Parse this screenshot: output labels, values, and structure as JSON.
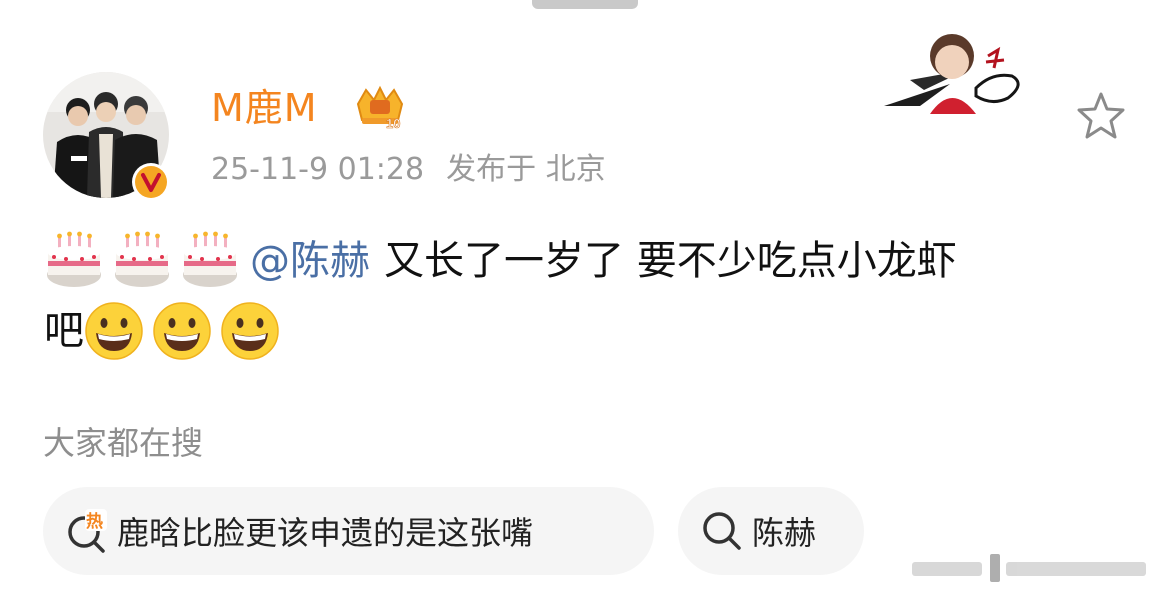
{
  "post": {
    "author": {
      "name": "M鹿M",
      "vip_level": "10"
    },
    "timestamp": "25-11-9 01:28",
    "location": "发布于 北京",
    "mention": "@陈赫",
    "text_line1": "又长了一岁了 要不少吃点小龙虾",
    "text_line2": "吧",
    "emojis": {
      "first_line": [
        "birthday-cake",
        "birthday-cake",
        "birthday-cake"
      ],
      "second_line": [
        "grinning-face",
        "grinning-face",
        "grinning-face"
      ]
    }
  },
  "trending": {
    "title": "大家都在搜",
    "items": [
      {
        "label": "鹿晗比脸更该申遗的是这张嘴",
        "icon": "hot-search-icon",
        "hot_mark": "热"
      },
      {
        "label": "陈赫",
        "icon": "search-icon"
      }
    ]
  },
  "colors": {
    "username": "#f4851f",
    "mention": "#4a6fa5",
    "meta_text": "#9a9a9a",
    "pill_bg": "#f5f5f5",
    "verified_badge": "#f5a623",
    "hot_mark": "#f4851f"
  }
}
